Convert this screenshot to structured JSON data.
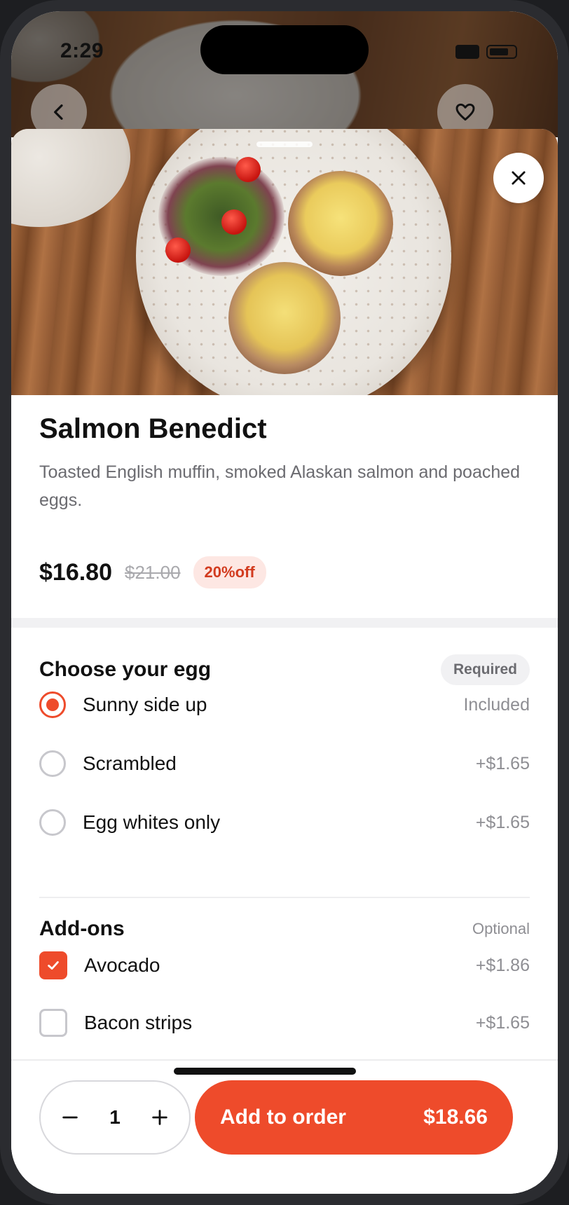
{
  "status_bar": {
    "time": "2:29"
  },
  "item": {
    "title": "Salmon Benedict",
    "description": "Toasted English muffin, smoked Alaskan salmon and poached eggs.",
    "price": "$16.80",
    "original_price": "$21.00",
    "discount": "20%off"
  },
  "egg_section": {
    "title": "Choose your egg",
    "badge": "Required",
    "options": [
      {
        "label": "Sunny side up",
        "price": "Included",
        "selected": true
      },
      {
        "label": "Scrambled",
        "price": "+$1.65",
        "selected": false
      },
      {
        "label": "Egg whites only",
        "price": "+$1.65",
        "selected": false
      }
    ]
  },
  "addons_section": {
    "title": "Add-ons",
    "badge": "Optional",
    "options": [
      {
        "label": "Avocado",
        "price": "+$1.86",
        "checked": true
      },
      {
        "label": "Bacon strips",
        "price": "+$1.65",
        "checked": false
      }
    ]
  },
  "order_bar": {
    "quantity": "1",
    "add_label": "Add to order",
    "total": "$18.66"
  },
  "colors": {
    "accent": "#ee4b2b",
    "muted": "#8e8e93"
  },
  "icons": [
    "back-icon",
    "heart-icon",
    "close-icon",
    "minus-icon",
    "plus-icon",
    "check-icon"
  ]
}
